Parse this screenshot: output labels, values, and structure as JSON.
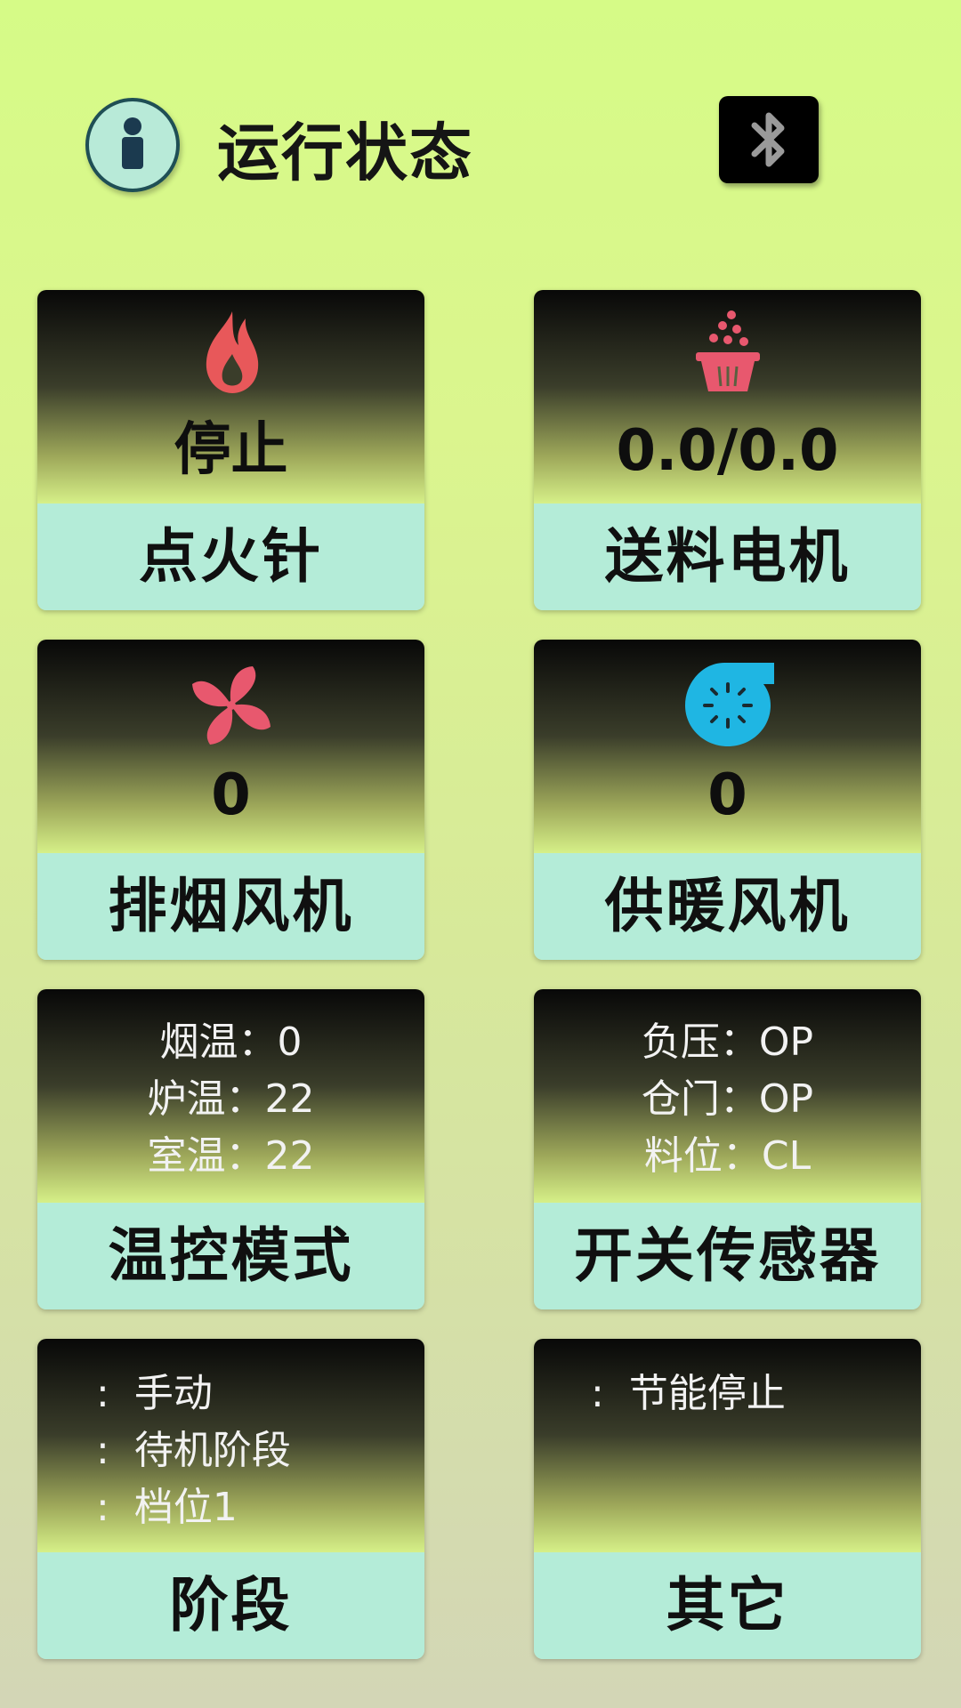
{
  "header": {
    "title": "运行状态",
    "avatar_icon": "user-icon",
    "bluetooth_icon": "bluetooth-icon"
  },
  "cards": {
    "igniter": {
      "icon": "flame-icon",
      "value": "停止",
      "label": "点火针",
      "icon_color": "#e8585a"
    },
    "feeder": {
      "icon": "basket-icon",
      "value": "0.0/0.0",
      "label": "送料电机",
      "icon_color": "#e8586e"
    },
    "exhaust_fan": {
      "icon": "fan-icon",
      "value": "0",
      "label": "排烟风机",
      "icon_color": "#e8586e"
    },
    "heating_fan": {
      "icon": "blower-icon",
      "value": "0",
      "label": "供暖风机",
      "icon_color": "#1fb6e3"
    },
    "temperature": {
      "label": "温控模式",
      "lines": [
        "烟温：0",
        "炉温：22",
        "室温：22"
      ]
    },
    "switch_sensor": {
      "label": "开关传感器",
      "lines": [
        "负压：OP",
        "仓门：OP",
        "料位：CL"
      ]
    },
    "stage": {
      "label": "阶段",
      "lines": [
        "手动",
        "待机阶段",
        "档位1"
      ]
    },
    "other": {
      "label": "其它",
      "lines": [
        "节能停止"
      ]
    }
  },
  "colors": {
    "card_label_bg": "#b4ecd8",
    "background_top": "#d6fb87",
    "background_bottom": "#d3d6b6"
  }
}
